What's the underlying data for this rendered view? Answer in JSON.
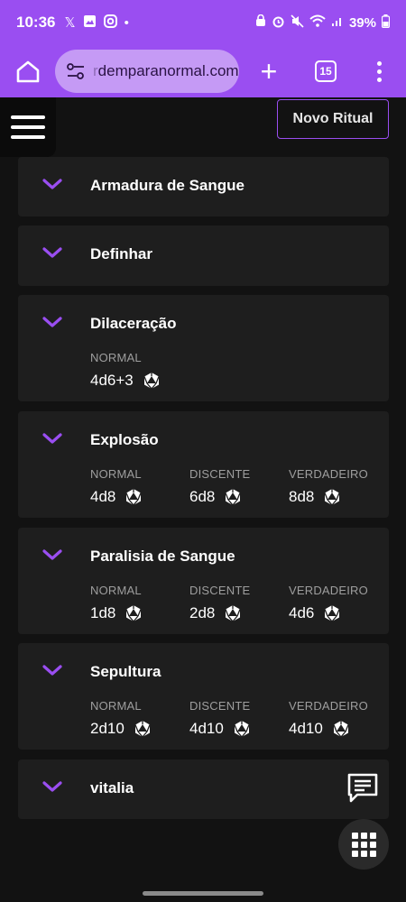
{
  "status_bar": {
    "time": "10:36",
    "battery": "39%",
    "left_icons": [
      "x-icon",
      "image-icon",
      "instagram-icon",
      "dot-icon"
    ],
    "right_icons": [
      "lock-icon",
      "alarm-icon",
      "mute-icon",
      "wifi-icon",
      "signal-icon",
      "battery-icon"
    ]
  },
  "browser": {
    "url_faded": "r",
    "url": "demparanormal.com",
    "tab_count": "15"
  },
  "header": {
    "new_ritual_label": "Novo Ritual"
  },
  "rituals": [
    {
      "name": "Armadura de Sangue",
      "damage": []
    },
    {
      "name": "Definhar",
      "damage": []
    },
    {
      "name": "Dilaceração",
      "damage": [
        {
          "label": "NORMAL",
          "value": "4d6+3"
        }
      ]
    },
    {
      "name": "Explosão",
      "damage": [
        {
          "label": "NORMAL",
          "value": "4d8"
        },
        {
          "label": "DISCENTE",
          "value": "6d8"
        },
        {
          "label": "VERDADEIRO",
          "value": "8d8"
        }
      ]
    },
    {
      "name": "Paralisia de Sangue",
      "damage": [
        {
          "label": "NORMAL",
          "value": "1d8"
        },
        {
          "label": "DISCENTE",
          "value": "2d8"
        },
        {
          "label": "VERDADEIRO",
          "value": "4d6"
        }
      ]
    },
    {
      "name": "Sepultura",
      "damage": [
        {
          "label": "NORMAL",
          "value": "2d10"
        },
        {
          "label": "DISCENTE",
          "value": "4d10"
        },
        {
          "label": "VERDADEIRO",
          "value": "4d10"
        }
      ]
    },
    {
      "name": "vitalia",
      "damage": []
    }
  ],
  "colors": {
    "accent": "#9a4ef1",
    "card_bg": "#1e1e1e",
    "page_bg": "#121212",
    "label": "#9e9e9e"
  }
}
